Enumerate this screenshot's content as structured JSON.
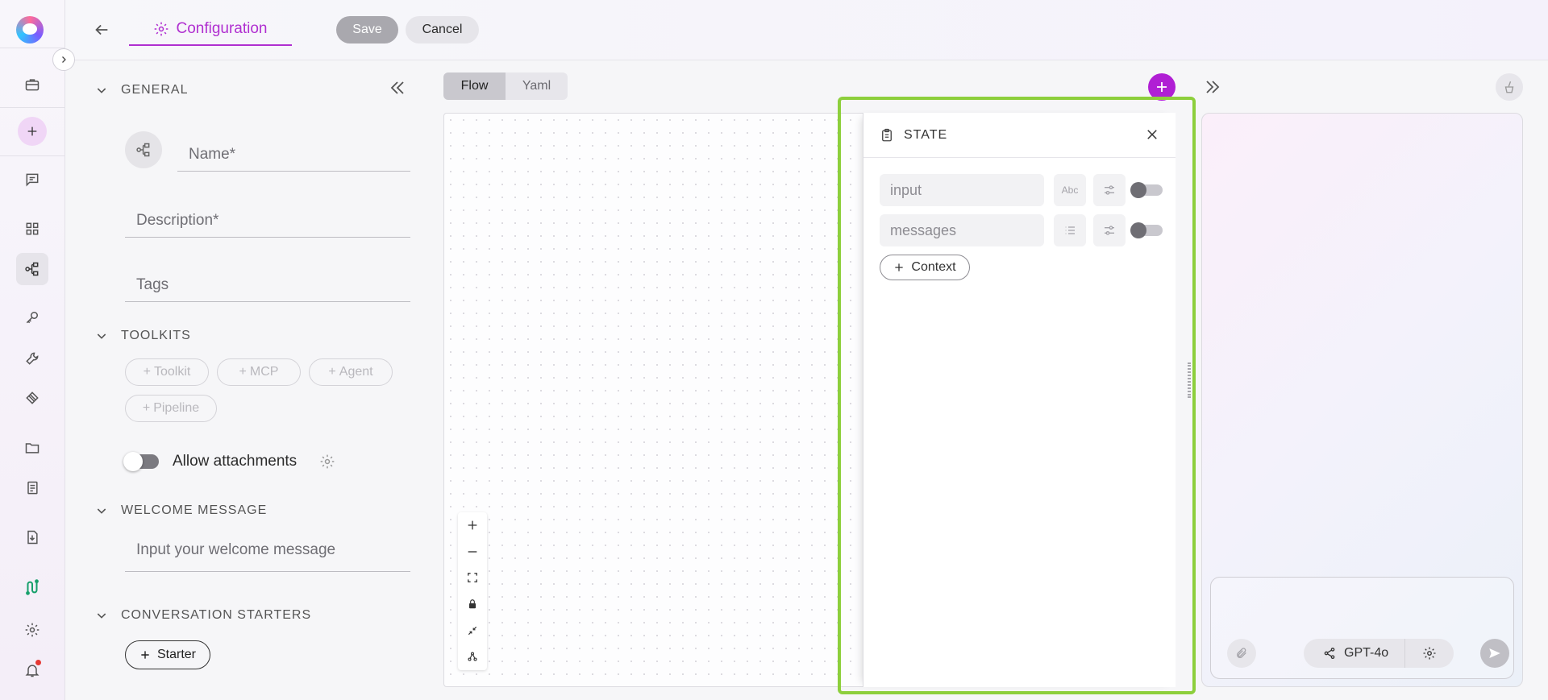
{
  "header": {
    "tab_label": "Configuration",
    "save_label": "Save",
    "cancel_label": "Cancel"
  },
  "config": {
    "general": {
      "title": "GENERAL",
      "name_placeholder": "Name*",
      "description_placeholder": "Description*",
      "tags_placeholder": "Tags"
    },
    "toolkits": {
      "title": "TOOLKITS",
      "buttons": [
        "Toolkit",
        "MCP",
        "Agent",
        "Pipeline"
      ]
    },
    "allow_attachments_label": "Allow attachments",
    "welcome": {
      "title": "WELCOME MESSAGE",
      "placeholder": "Input your welcome message"
    },
    "starters": {
      "title": "CONVERSATION STARTERS",
      "button_label": "Starter"
    }
  },
  "flow": {
    "view_tabs": [
      "Flow",
      "Yaml"
    ],
    "active_view": "Flow"
  },
  "state_panel": {
    "title": "STATE",
    "variables": [
      {
        "name": "input",
        "type_icon": "text-type-icon",
        "type_glyph": "Abc",
        "enabled": false
      },
      {
        "name": "messages",
        "type_icon": "list-type-icon",
        "type_glyph": "",
        "enabled": false
      }
    ],
    "context_button": "Context"
  },
  "chat": {
    "model": "GPT-4o"
  },
  "colors": {
    "accent": "#b02fd0",
    "fab": "#b01fd4",
    "highlight": "#8dcf3c"
  }
}
